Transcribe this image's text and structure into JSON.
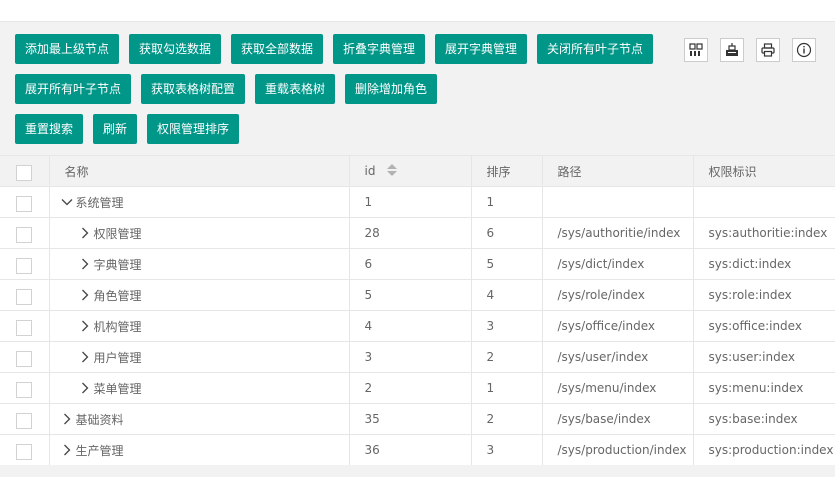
{
  "toolbar": {
    "buttons": [
      {
        "label": "添加最上级节点"
      },
      {
        "label": "获取勾选数据"
      },
      {
        "label": "获取全部数据"
      },
      {
        "label": "折叠字典管理"
      },
      {
        "label": "展开字典管理"
      },
      {
        "label": "关闭所有叶子节点"
      },
      {
        "label": "展开所有叶子节点"
      },
      {
        "label": "获取表格树配置"
      },
      {
        "label": "重载表格树"
      },
      {
        "label": "删除增加角色"
      },
      {
        "label": "重置搜索"
      },
      {
        "label": "刷新"
      },
      {
        "label": "权限管理排序"
      }
    ],
    "tools": [
      {
        "icon": "columns-filter-icon"
      },
      {
        "icon": "export-icon"
      },
      {
        "icon": "print-icon"
      },
      {
        "icon": "info-icon"
      }
    ]
  },
  "table": {
    "headers": {
      "name": "名称",
      "id": "id",
      "sort": "排序",
      "path": "路径",
      "perm": "权限标识"
    },
    "rows": [
      {
        "name": "系统管理",
        "id": "1",
        "sort": "1",
        "path": "",
        "perm": "",
        "level": 0,
        "expanded": true
      },
      {
        "name": "权限管理",
        "id": "28",
        "sort": "6",
        "path": "/sys/authoritie/index",
        "perm": "sys:authoritie:index",
        "level": 1,
        "expanded": false
      },
      {
        "name": "字典管理",
        "id": "6",
        "sort": "5",
        "path": "/sys/dict/index",
        "perm": "sys:dict:index",
        "level": 1,
        "expanded": false
      },
      {
        "name": "角色管理",
        "id": "5",
        "sort": "4",
        "path": "/sys/role/index",
        "perm": "sys:role:index",
        "level": 1,
        "expanded": false
      },
      {
        "name": "机构管理",
        "id": "4",
        "sort": "3",
        "path": "/sys/office/index",
        "perm": "sys:office:index",
        "level": 1,
        "expanded": false
      },
      {
        "name": "用户管理",
        "id": "3",
        "sort": "2",
        "path": "/sys/user/index",
        "perm": "sys:user:index",
        "level": 1,
        "expanded": false
      },
      {
        "name": "菜单管理",
        "id": "2",
        "sort": "1",
        "path": "/sys/menu/index",
        "perm": "sys:menu:index",
        "level": 1,
        "expanded": false
      },
      {
        "name": "基础资料",
        "id": "35",
        "sort": "2",
        "path": "/sys/base/index",
        "perm": "sys:base:index",
        "level": 0,
        "expanded": false
      },
      {
        "name": "生产管理",
        "id": "36",
        "sort": "3",
        "path": "/sys/production/index",
        "perm": "sys:production:index",
        "level": 0,
        "expanded": false
      }
    ]
  },
  "colors": {
    "primary": "#009688",
    "border": "#e6e6e6",
    "toolbar_bg": "#f2f2f2"
  }
}
